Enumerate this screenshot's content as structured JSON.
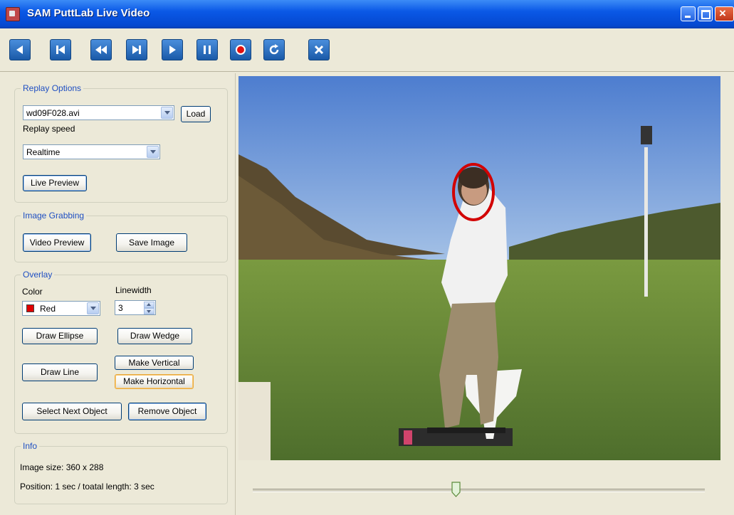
{
  "window": {
    "title": "SAM PuttLab Live Video"
  },
  "toolbar": {
    "buttons": [
      "play-backward-icon",
      "skip-to-start-icon",
      "rewind-icon",
      "step-forward-icon",
      "play-icon",
      "pause-icon",
      "record-icon",
      "refresh-icon",
      "close-icon"
    ]
  },
  "replay": {
    "legend": "Replay Options",
    "file": "wd09F028.avi",
    "load_label": "Load",
    "speed_label": "Replay speed",
    "speed": "Realtime",
    "live_preview_label": "Live Preview"
  },
  "grab": {
    "legend": "Image Grabbing",
    "video_preview_label": "Video Preview",
    "save_image_label": "Save Image"
  },
  "overlay": {
    "legend": "Overlay",
    "color_label": "Color",
    "color_value": "Red",
    "color_hex": "#e00000",
    "linewidth_label": "Linewidth",
    "linewidth_value": "3",
    "draw_ellipse": "Draw Ellipse",
    "draw_wedge": "Draw Wedge",
    "draw_line": "Draw Line",
    "make_vertical": "Make Vertical",
    "make_horizontal": "Make Horizontal",
    "select_next": "Select Next Object",
    "remove_object": "Remove Object"
  },
  "info": {
    "legend": "Info",
    "image_size": "Image size:   360 x 288",
    "position": "Position: 1 sec / toatal length: 3 sec"
  },
  "playback": {
    "position_fraction": 0.45
  }
}
